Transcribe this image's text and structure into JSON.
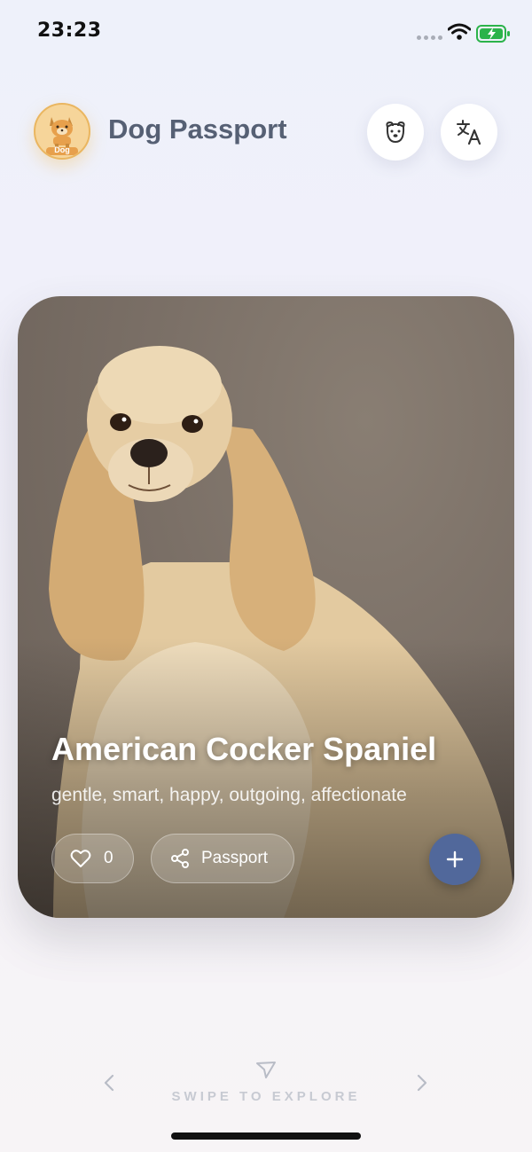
{
  "status_bar": {
    "time": "23:23"
  },
  "header": {
    "title": "Dog Passport",
    "logo_text": "Dog",
    "dog_button_icon": "dog-face-icon",
    "translate_button_icon": "translate-icon"
  },
  "card": {
    "breed": "American Cocker Spaniel",
    "traits": "gentle, smart, happy, outgoing, affectionate",
    "likes": "0",
    "passport_label": "Passport",
    "accent": "#51689b"
  },
  "footer": {
    "swipe_label": "SWIPE TO EXPLORE"
  }
}
